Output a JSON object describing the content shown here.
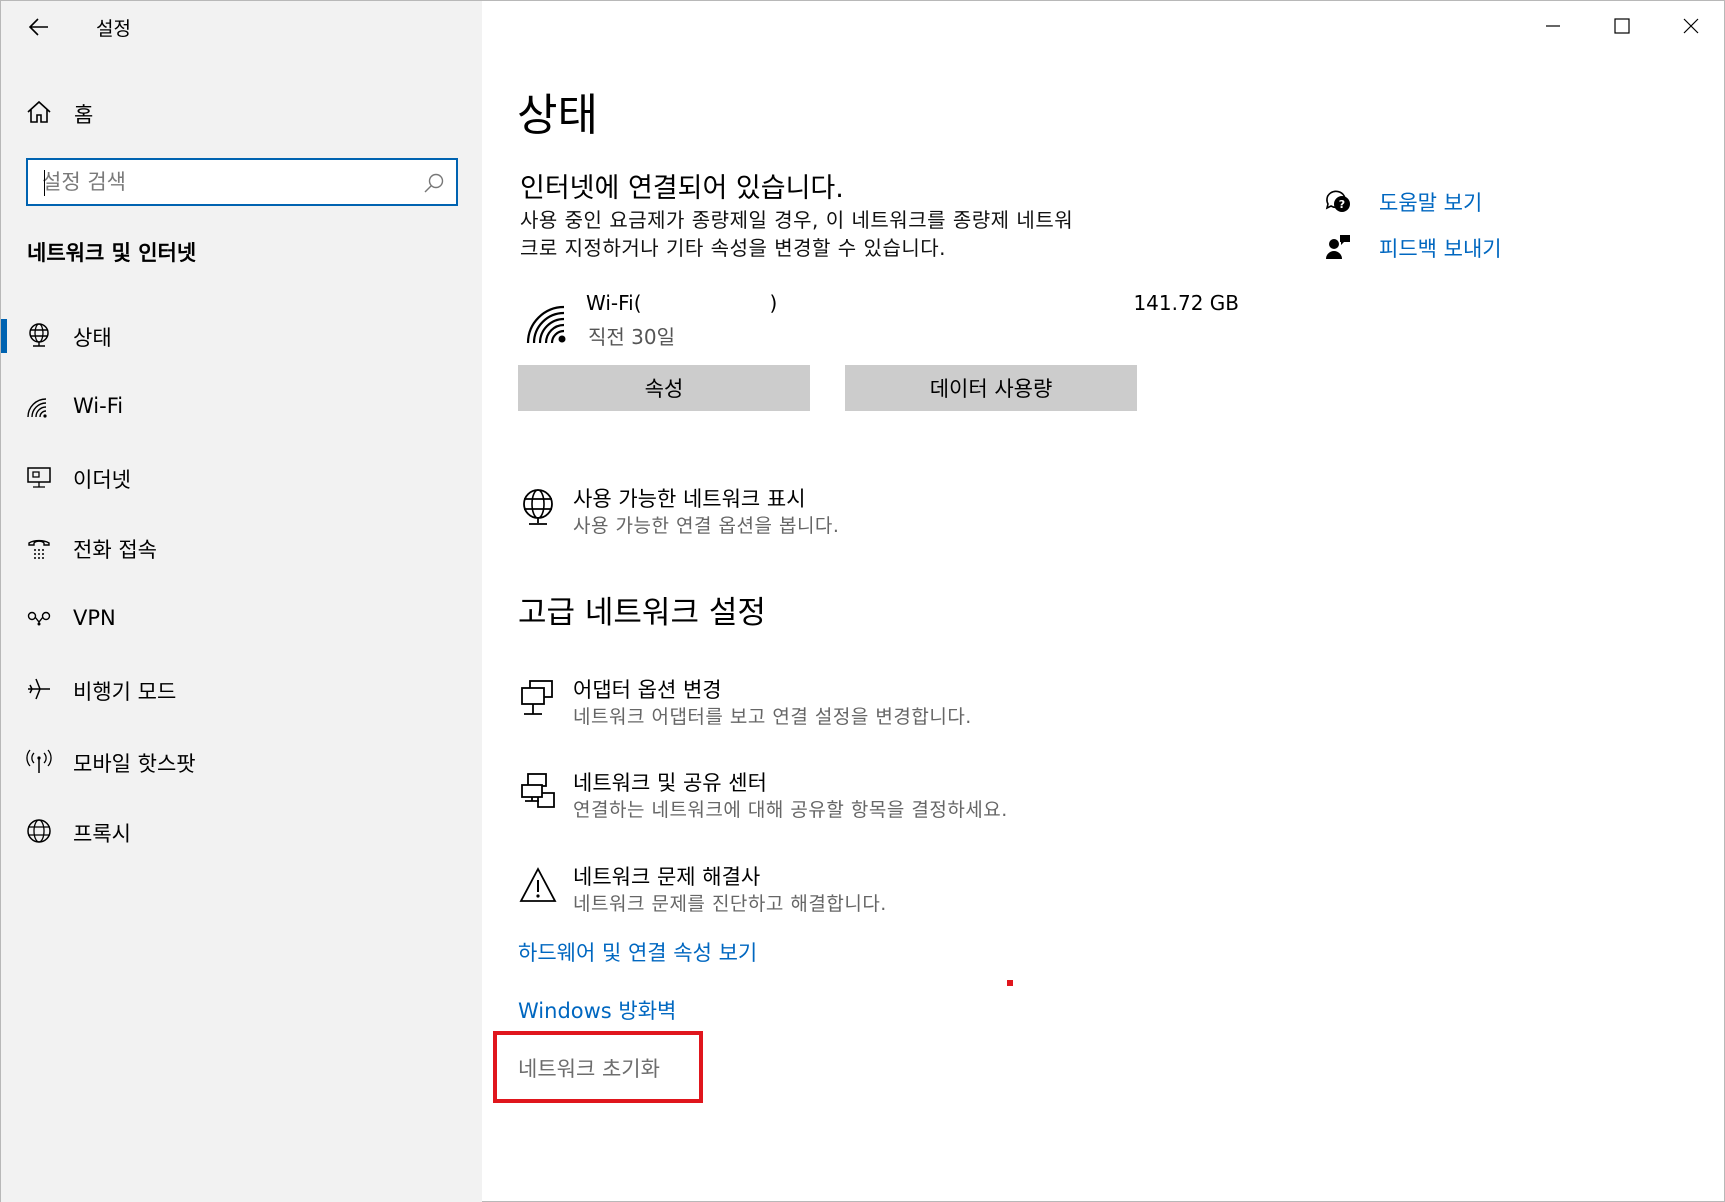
{
  "app": {
    "title": "설정"
  },
  "sidebar": {
    "home_label": "홈",
    "search": {
      "placeholder": "설정 검색"
    },
    "section_title": "네트워크 및 인터넷",
    "items": [
      {
        "label": "상태",
        "icon": "globe-network-icon",
        "selected": true
      },
      {
        "label": "Wi-Fi",
        "icon": "wifi-icon",
        "selected": false
      },
      {
        "label": "이더넷",
        "icon": "ethernet-icon",
        "selected": false
      },
      {
        "label": "전화 접속",
        "icon": "dialup-icon",
        "selected": false
      },
      {
        "label": "VPN",
        "icon": "vpn-icon",
        "selected": false
      },
      {
        "label": "비행기 모드",
        "icon": "airplane-icon",
        "selected": false
      },
      {
        "label": "모바일 핫스팟",
        "icon": "hotspot-icon",
        "selected": false
      },
      {
        "label": "프록시",
        "icon": "globe-icon",
        "selected": false
      }
    ]
  },
  "main": {
    "page_title": "상태",
    "status_heading": "인터넷에 연결되어 있습니다.",
    "status_desc_line1": "사용 중인 요금제가 종량제일 경우, 이 네트워크를 종량제 네트워",
    "status_desc_line2": "크로 지정하거나 기타 속성을 변경할 수 있습니다.",
    "connection": {
      "name_prefix": "Wi-Fi(",
      "name_suffix": ")",
      "sub": "직전 30일",
      "usage": "141.72 GB"
    },
    "buttons": {
      "properties": "속성",
      "data_usage": "데이터 사용량"
    },
    "show_networks": {
      "title": "사용 가능한 네트워크 표시",
      "sub": "사용 가능한 연결 옵션을 봅니다."
    },
    "advanced_heading": "고급 네트워크 설정",
    "advanced_items": [
      {
        "title": "어댑터 옵션 변경",
        "sub": "네트워크 어댑터를 보고 연결 설정을 변경합니다.",
        "icon": "adapter-icon"
      },
      {
        "title": "네트워크 및 공유 센터",
        "sub": "연결하는 네트워크에 대해 공유할 항목을 결정하세요.",
        "icon": "sharing-center-icon"
      },
      {
        "title": "네트워크 문제 해결사",
        "sub": "네트워크 문제를 진단하고 해결합니다.",
        "icon": "warning-icon"
      }
    ],
    "links": {
      "hardware": "하드웨어 및 연결 속성 보기",
      "firewall": "Windows 방화벽",
      "reset": "네트워크 초기화"
    },
    "side_links": {
      "help": "도움말 보기",
      "feedback": "피드백 보내기"
    }
  },
  "colors": {
    "accent": "#0063b1",
    "link": "#0067c0",
    "highlight": "#e0161d",
    "button": "#cccccc",
    "sidebar_bg": "#f2f2f2"
  }
}
